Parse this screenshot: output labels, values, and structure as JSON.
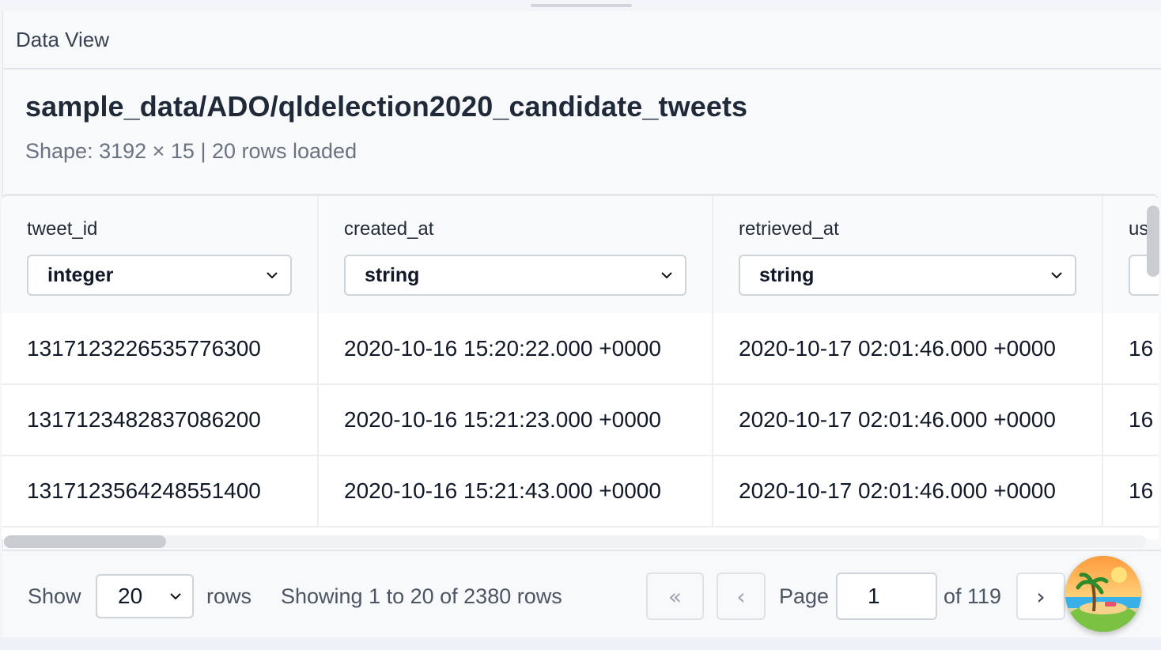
{
  "panel": {
    "title": "Data View"
  },
  "dataset": {
    "title": "sample_data/ADO/qldelection2020_candidate_tweets",
    "shape_text": "Shape: 3192 × 15 | 20 rows loaded"
  },
  "table": {
    "columns": [
      {
        "name": "tweet_id",
        "type": "integer"
      },
      {
        "name": "created_at",
        "type": "string"
      },
      {
        "name": "retrieved_at",
        "type": "string"
      },
      {
        "name": "us",
        "type": ""
      }
    ],
    "rows": [
      [
        "1317123226535776300",
        "2020-10-16 15:20:22.000 +0000",
        "2020-10-17 02:01:46.000 +0000",
        "16"
      ],
      [
        "1317123482837086200",
        "2020-10-16 15:21:23.000 +0000",
        "2020-10-17 02:01:46.000 +0000",
        "16"
      ],
      [
        "1317123564248551400",
        "2020-10-16 15:21:43.000 +0000",
        "2020-10-17 02:01:46.000 +0000",
        "16"
      ]
    ]
  },
  "footer": {
    "show_label": "Show",
    "page_size": "20",
    "rows_label": "rows",
    "showing_text": "Showing 1 to 20 of 2380 rows",
    "first_label": "«",
    "prev_label": "‹",
    "page_label": "Page",
    "page_value": "1",
    "of_text": "of 119",
    "next_label": "›"
  },
  "icons": {
    "chevron": "chevron-down-icon",
    "avatar": "beach-avatar-icon"
  }
}
